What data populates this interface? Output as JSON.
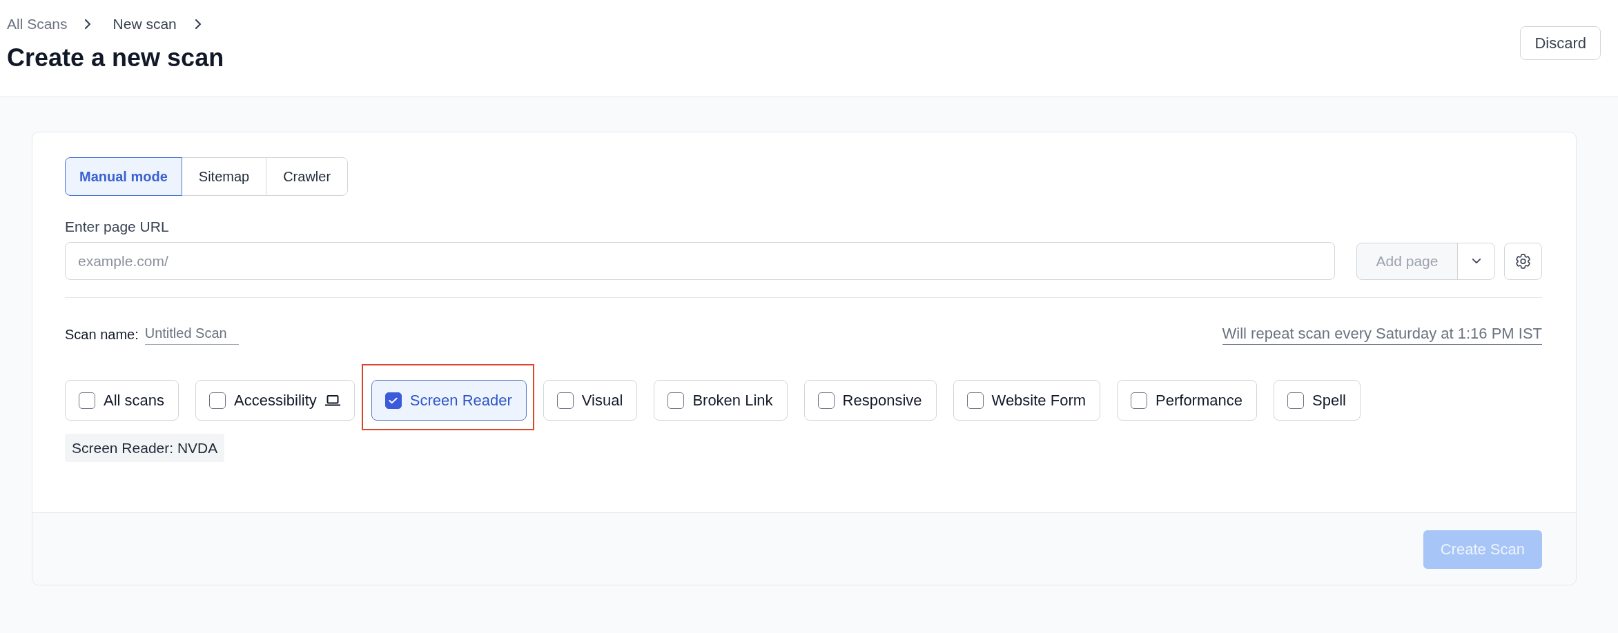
{
  "breadcrumb": [
    {
      "label": "All Scans"
    },
    {
      "label": "New scan"
    }
  ],
  "title": "Create a new scan",
  "discard_button": "Discard",
  "modes": [
    {
      "label": "Manual mode",
      "selected": true
    },
    {
      "label": "Sitemap",
      "selected": false
    },
    {
      "label": "Crawler",
      "selected": false
    }
  ],
  "url_field": {
    "label": "Enter page URL",
    "placeholder": "example.com/"
  },
  "add_page_button": {
    "label": "Add page",
    "disabled": true
  },
  "scan_name": {
    "label": "Scan name:",
    "placeholder": "Untitled Scan"
  },
  "schedule": "Will repeat scan every Saturday at 1:16 PM IST",
  "scan_types": [
    {
      "label": "All scans",
      "kind": "plain",
      "checked": false,
      "highlighted": false
    },
    {
      "label": "Accessibility",
      "kind": "device",
      "checked": false,
      "highlighted": false
    },
    {
      "label": "Screen Reader",
      "kind": "plain",
      "checked": true,
      "highlighted": true
    },
    {
      "label": "Visual",
      "kind": "plain",
      "checked": false,
      "highlighted": false
    },
    {
      "label": "Broken Link",
      "kind": "plain",
      "checked": false,
      "highlighted": false
    },
    {
      "label": "Responsive",
      "kind": "plain",
      "checked": false,
      "highlighted": false
    },
    {
      "label": "Website Form",
      "kind": "plain",
      "checked": false,
      "highlighted": false
    },
    {
      "label": "Performance",
      "kind": "plain",
      "checked": false,
      "highlighted": false
    },
    {
      "label": "Spell",
      "kind": "plain",
      "checked": false,
      "highlighted": false
    }
  ],
  "selected_options": [
    "Screen Reader: NVDA"
  ],
  "create_button": {
    "label": "Create Scan",
    "disabled": true
  }
}
